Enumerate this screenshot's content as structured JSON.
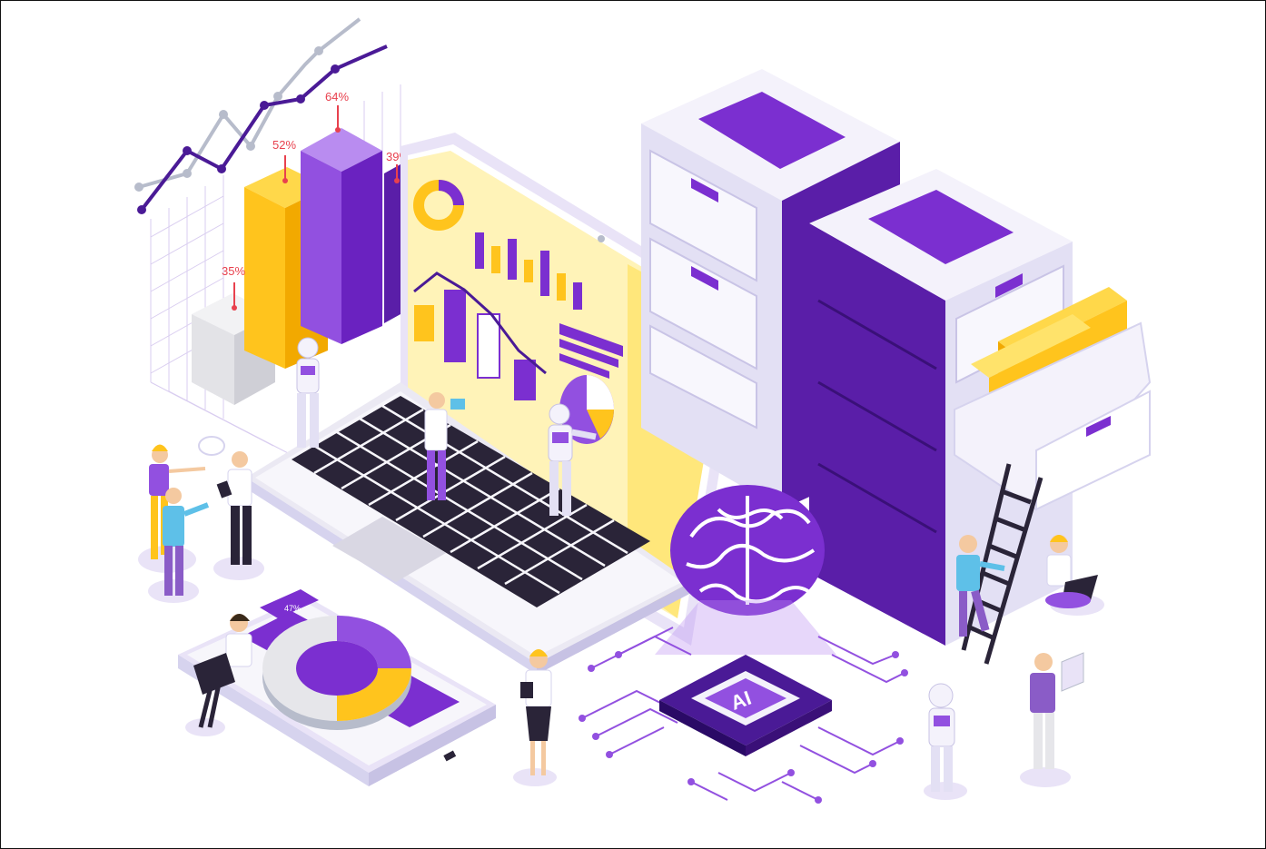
{
  "illustration": {
    "bar_labels": [
      "35%",
      "52%",
      "64%",
      "39%"
    ],
    "chip_label": "AI",
    "phone_battery": "47%"
  },
  "colors": {
    "purple": "#7b2fd0",
    "purple_dark": "#4a1a96",
    "purple_light": "#b98cf0",
    "yellow": "#ffc41d",
    "yellow_light": "#ffe36b",
    "lavender": "#e9e3f7",
    "lavender_mid": "#d6d3ee",
    "white": "#ffffff",
    "grey": "#e6e6ea",
    "red": "#e8414e"
  }
}
